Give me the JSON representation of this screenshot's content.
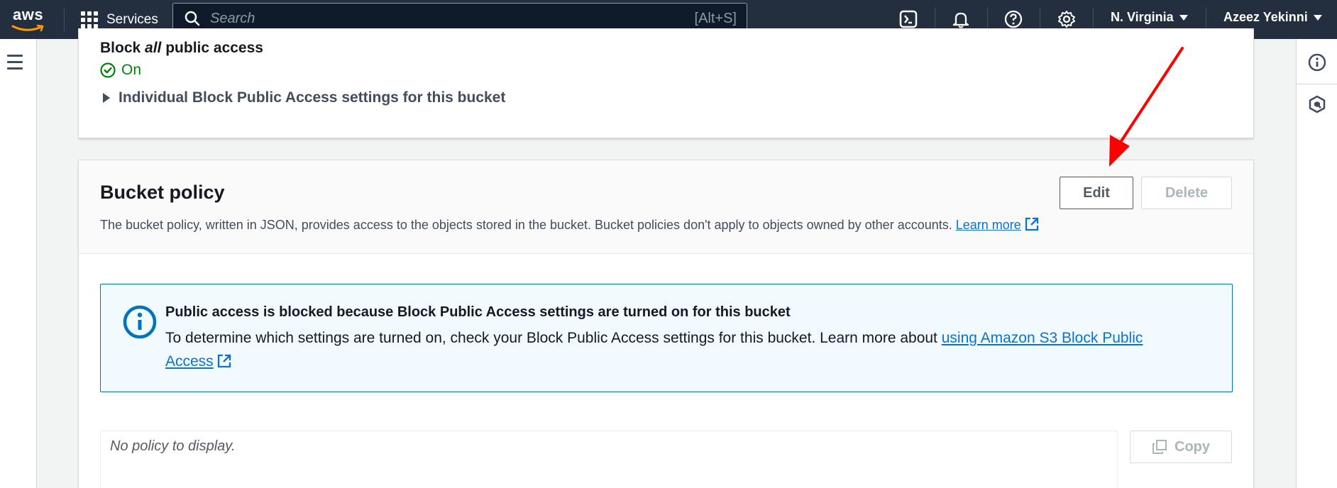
{
  "topnav": {
    "logo_text": "aws",
    "services_label": "Services",
    "search_placeholder": "Search",
    "search_shortcut": "[Alt+S]",
    "region": "N. Virginia",
    "user": "Azeez Yekinni"
  },
  "block_public_access": {
    "label_before": "Block ",
    "label_emph": "all",
    "label_after": " public access",
    "status": "On",
    "expander_label": "Individual Block Public Access settings for this bucket"
  },
  "bucket_policy": {
    "title": "Bucket policy",
    "description": "The bucket policy, written in JSON, provides access to the objects stored in the bucket. Bucket policies don't apply to objects owned by other accounts.",
    "learn_more": "Learn more",
    "edit_label": "Edit",
    "delete_label": "Delete",
    "alert": {
      "title": "Public access is blocked because Block Public Access settings are turned on for this bucket",
      "body": "To determine which settings are turned on, check your Block Public Access settings for this bucket. Learn more about",
      "link": "using Amazon S3 Block Public Access"
    },
    "policy_placeholder": "No policy to display.",
    "copy_label": "Copy"
  },
  "colors": {
    "nav_bg": "#232f3e",
    "link": "#0972d3",
    "success": "#037f0c",
    "alert_border": "#0073bb",
    "annotation_arrow": "#ff0000"
  }
}
